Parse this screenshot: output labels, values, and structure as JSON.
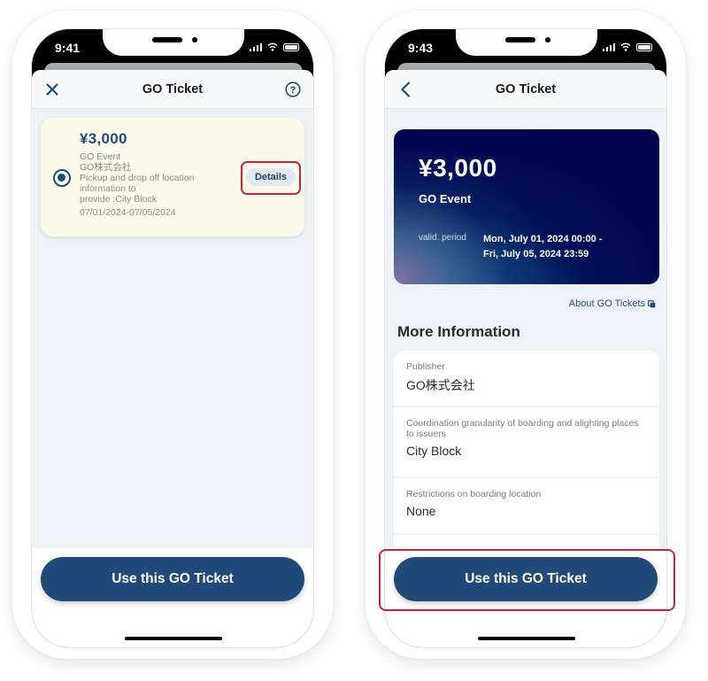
{
  "colors": {
    "brand_navy": "#214a79",
    "highlight_red": "#c8203c",
    "card_cream": "#fbf9ea",
    "screen_bg": "#eef2f6"
  },
  "screens": [
    {
      "status_time": "9:41",
      "nav": {
        "title": "GO Ticket",
        "left_icon": "close-icon",
        "right_icon": "help-icon"
      },
      "ticket": {
        "selected": true,
        "price": "¥3,000",
        "event": "GO Event",
        "publisher": "GO株式会社",
        "pickup_line1": "Pickup and drop off location",
        "pickup_line2": "information to",
        "pickup_line3": "provide :City Block",
        "dates": "07/01/2024-07/05/2024",
        "details_label": "Details",
        "details_highlighted": true
      },
      "cta_label": "Use this GO Ticket"
    },
    {
      "status_time": "9:43",
      "nav": {
        "title": "GO Ticket",
        "left_icon": "back-chevron-icon"
      },
      "hero": {
        "price": "¥3,000",
        "event": "GO Event",
        "valid_label": "valid. period",
        "valid_from": "Mon, July 01, 2024 00:00 -",
        "valid_to": "Fri, July 05, 2024 23:59"
      },
      "about_link": "About GO Tickets",
      "section_title": "More Information",
      "info": [
        {
          "label": "Publisher",
          "value": "GO株式会社"
        },
        {
          "label": "Coordination granularity of boarding and alighting places to issuers",
          "value": "City Block"
        },
        {
          "label": "Restrictions on boarding location",
          "value": "None"
        }
      ],
      "cta_label": "Use this GO Ticket",
      "cta_highlighted": true
    }
  ]
}
